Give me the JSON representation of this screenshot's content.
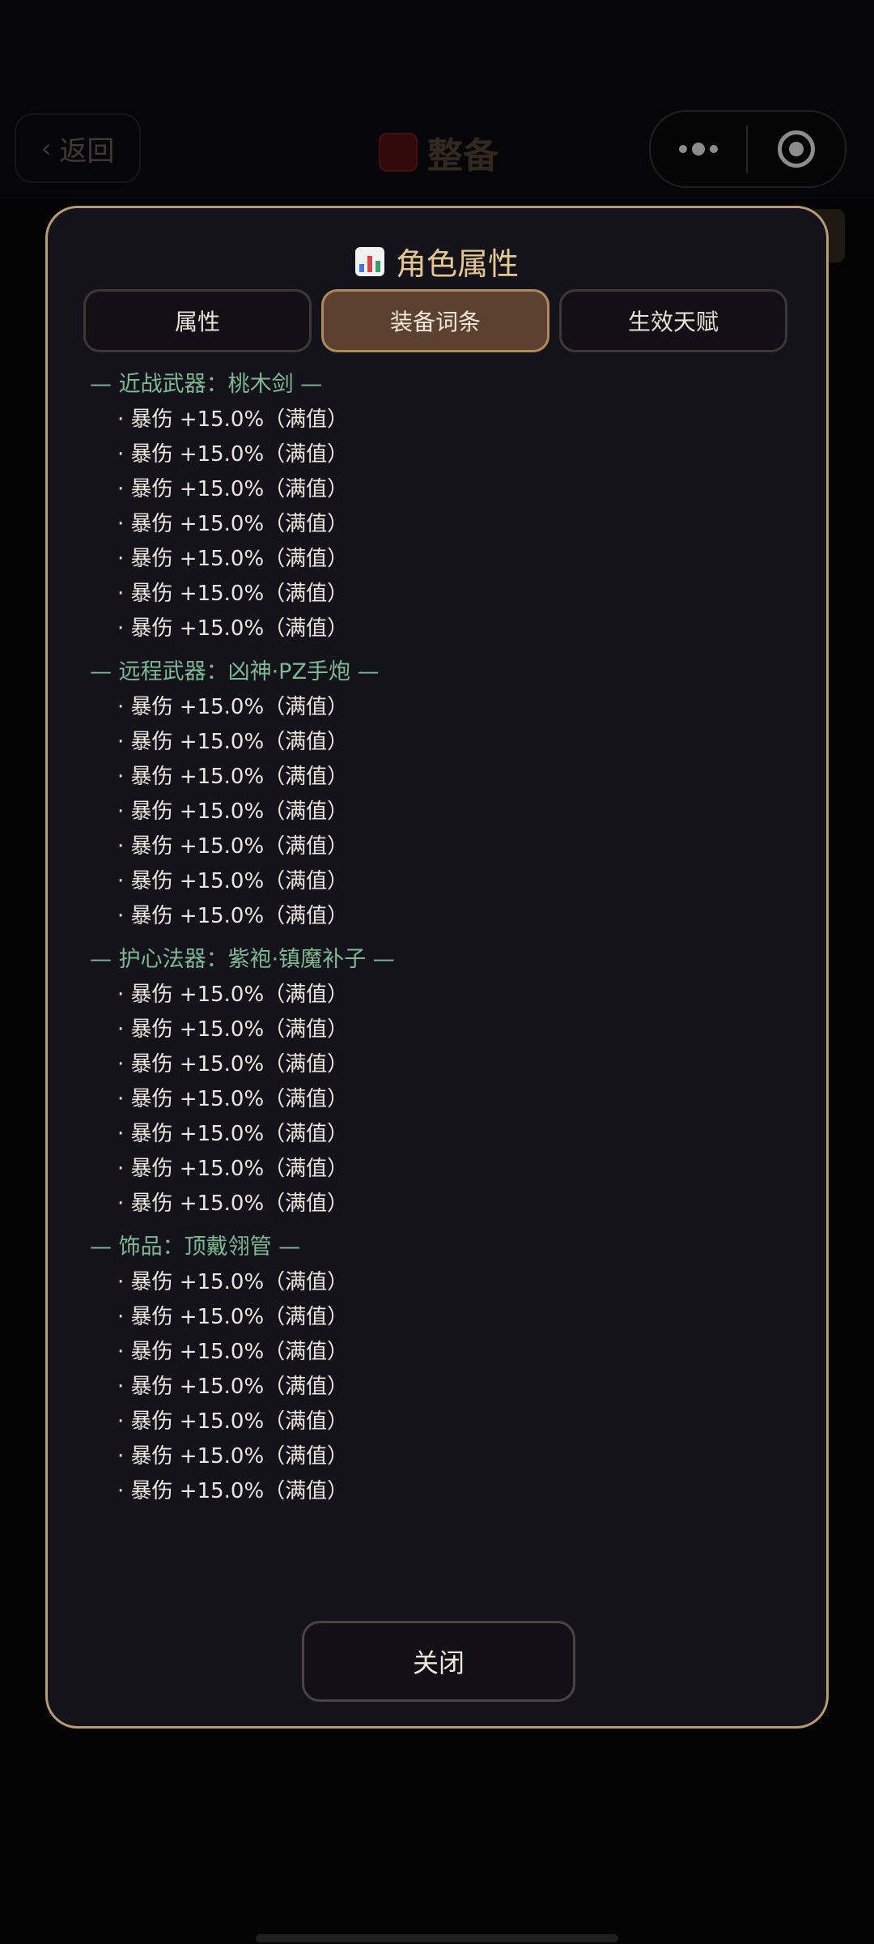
{
  "header": {
    "back_label": "返回",
    "title": "整备"
  },
  "modal": {
    "title": "角色属性",
    "tabs": [
      {
        "label": "属性",
        "active": false
      },
      {
        "label": "装备词条",
        "active": true
      },
      {
        "label": "生效天赋",
        "active": false
      }
    ],
    "sections": [
      {
        "title": "— 近战武器：桃木剑 —",
        "affixes": [
          "· 暴伤 +15.0%（满值）",
          "· 暴伤 +15.0%（满值）",
          "· 暴伤 +15.0%（满值）",
          "· 暴伤 +15.0%（满值）",
          "· 暴伤 +15.0%（满值）",
          "· 暴伤 +15.0%（满值）",
          "· 暴伤 +15.0%（满值）"
        ]
      },
      {
        "title": "— 远程武器：凶神·PZ手炮 —",
        "affixes": [
          "· 暴伤 +15.0%（满值）",
          "· 暴伤 +15.0%（满值）",
          "· 暴伤 +15.0%（满值）",
          "· 暴伤 +15.0%（满值）",
          "· 暴伤 +15.0%（满值）",
          "· 暴伤 +15.0%（满值）",
          "· 暴伤 +15.0%（满值）"
        ]
      },
      {
        "title": "— 护心法器：紫袍·镇魔补子 —",
        "affixes": [
          "· 暴伤 +15.0%（满值）",
          "· 暴伤 +15.0%（满值）",
          "· 暴伤 +15.0%（满值）",
          "· 暴伤 +15.0%（满值）",
          "· 暴伤 +15.0%（满值）",
          "· 暴伤 +15.0%（满值）",
          "· 暴伤 +15.0%（满值）"
        ]
      },
      {
        "title": "— 饰品：顶戴翎管 —",
        "affixes": [
          "· 暴伤 +15.0%（满值）",
          "· 暴伤 +15.0%（满值）",
          "· 暴伤 +15.0%（满值）",
          "· 暴伤 +15.0%（满值）",
          "· 暴伤 +15.0%（满值）",
          "· 暴伤 +15.0%（满值）",
          "· 暴伤 +15.0%（满值）"
        ]
      }
    ],
    "close_label": "关闭"
  },
  "colors": {
    "accent_gold": "#b89c78",
    "section_green": "#7fb893",
    "tab_active": "#5b4130"
  }
}
